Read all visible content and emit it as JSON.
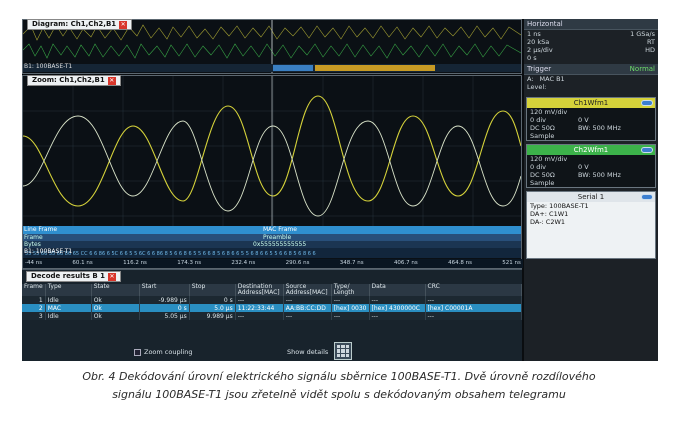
{
  "diagram_window": {
    "title": "Diagram: Ch1,Ch2,B1",
    "bus_label": "B1: 100BASE-T1"
  },
  "zoom_window": {
    "title": "Zoom: Ch1,Ch2,B1",
    "bus_rows": [
      "Line Frame",
      "Frame",
      "Bytes",
      "B1: 100BASE-T1"
    ],
    "mac_frame_label": "MAC Frame",
    "preamble_label": "Preamble",
    "preamble_value": "0x555555555555",
    "tick_labels": [
      "-44 ns",
      "60.1 ns",
      "116.2 ns",
      "174.3 ns",
      "232.4 ns",
      "290.6 ns",
      "348.7 ns",
      "406.7 ns",
      "464.8 ns",
      "521 ns"
    ]
  },
  "decode": {
    "title": "Decode results B 1",
    "columns": [
      "Frame",
      "Type",
      "State",
      "Start",
      "Stop",
      "Destination Address[MAC]",
      "Source Address[MAC]",
      "Type/ Length",
      "Data",
      "CRC"
    ],
    "rows": [
      {
        "frame": "1",
        "type": "Idle",
        "state": "Ok",
        "start": "-9.989 µs",
        "stop": "0 s",
        "dest": "---",
        "src": "---",
        "len": "---",
        "data": "---",
        "crc": "---"
      },
      {
        "frame": "2",
        "type": "MAC",
        "state": "Ok",
        "start": "0 s",
        "stop": "5.0 µs",
        "dest": "11:22:33:44",
        "src": "AA:BB:CC:DD",
        "len": "[hex] 0030",
        "data": "[hex] 4300000C",
        "crc": "[hex] C00001A"
      },
      {
        "frame": "3",
        "type": "Idle",
        "state": "Ok",
        "start": "5.05 µs",
        "stop": "9.989 µs",
        "dest": "---",
        "src": "---",
        "len": "---",
        "data": "---",
        "crc": "---"
      }
    ],
    "zoom_coupling_label": "Zoom coupling",
    "show_details_label": "Show details"
  },
  "panel": {
    "horizontal": {
      "title": "Horizontal",
      "rows": [
        [
          "1 ns",
          "1 GSa/s"
        ],
        [
          "20 kSa",
          "RT"
        ],
        [
          "2 µs/div",
          "HD"
        ],
        [
          "0 s",
          ""
        ]
      ]
    },
    "trigger": {
      "title": "Trigger",
      "mode": "Normal",
      "source": "A:",
      "type": "MAC B1",
      "level": "Level:"
    },
    "ch1": {
      "title": "Ch1Wfm1",
      "scale": "120 mV/div",
      "offset": "0 V",
      "pos": "0 div",
      "coupling": "DC 50Ω",
      "bw": "BW: 500 MHz",
      "mode": "Sample"
    },
    "ch2": {
      "title": "Ch2Wfm1",
      "scale": "120 mV/div",
      "offset": "0 V",
      "pos": "0 div",
      "coupling": "DC 50Ω",
      "bw": "BW: 500 MHz",
      "mode": "Sample"
    },
    "serial": {
      "title": "Serial 1",
      "type": "Type: 100BASE-T1",
      "da_plus": "DA+: C1W1",
      "da_minus": "DA-: C2W1"
    }
  },
  "caption": {
    "line1": "Obr. 4  Dekódování úrovní elektrického signálu sběrnice 100BASE-T1. Dvě úrovně rozdílového",
    "line2": "signálu 100BASE-T1 jsou zřetelně vidět spolu s dekódovaným obsahem telegramu"
  },
  "colors": {
    "ch1": "#d5d23a",
    "ch2": "#3cb24a",
    "select": "#2a8fc2"
  }
}
